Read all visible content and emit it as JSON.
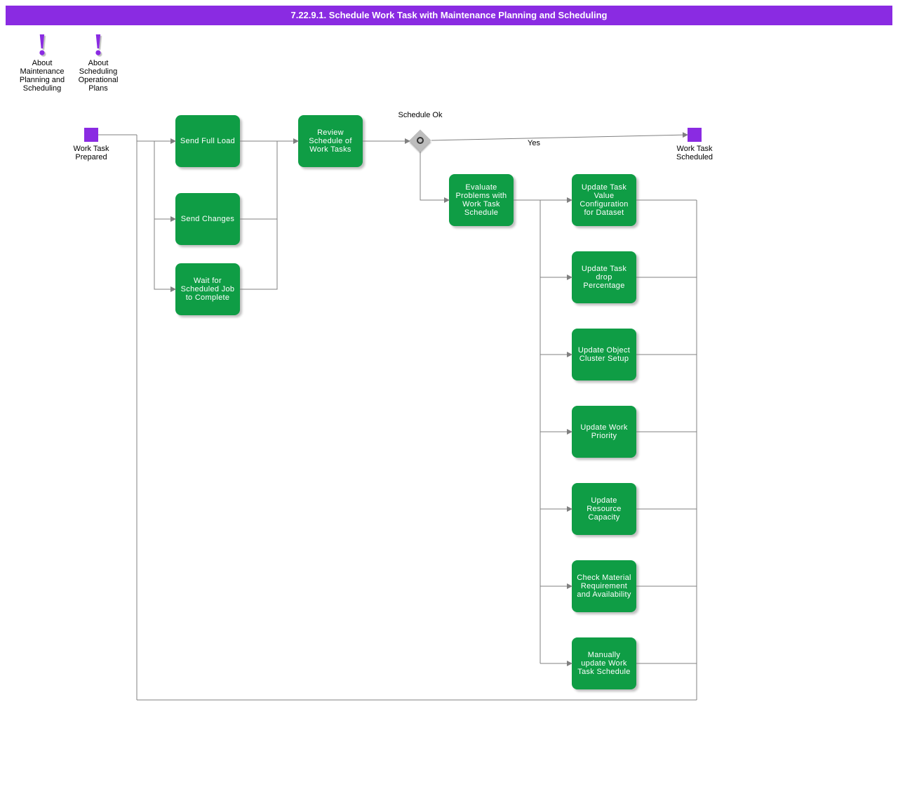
{
  "header": {
    "title": "7.22.9.1. Schedule Work Task with Maintenance Planning and Scheduling"
  },
  "notes": [
    {
      "label": "About Maintenance Planning and Scheduling"
    },
    {
      "label": "About Scheduling Operational Plans"
    }
  ],
  "events": {
    "start": {
      "label": "Work Task Prepared"
    },
    "end": {
      "label": "Work Task Scheduled"
    }
  },
  "tasks": {
    "send_full_load": "Send Full Load",
    "send_changes": "Send Changes",
    "wait_job": "Wait for Scheduled Job to Complete",
    "review": "Review Schedule of Work Tasks",
    "evaluate": "Evaluate Problems with Work Task Schedule",
    "upd_value": "Update Task Value Configuration for Dataset",
    "upd_drop": "Update Task drop Percentage",
    "upd_cluster": "Update Object Cluster Setup",
    "upd_priority": "Update Work Priority",
    "upd_capacity": "Update Resource Capacity",
    "check_material": "Check Material Requirement and Availability",
    "manual": "Manually update Work Task Schedule"
  },
  "gateway": {
    "label": "Schedule Ok",
    "yes": "Yes"
  },
  "colors": {
    "accent": "#8a2be2",
    "task": "#0f9d45",
    "connector": "#808080"
  }
}
